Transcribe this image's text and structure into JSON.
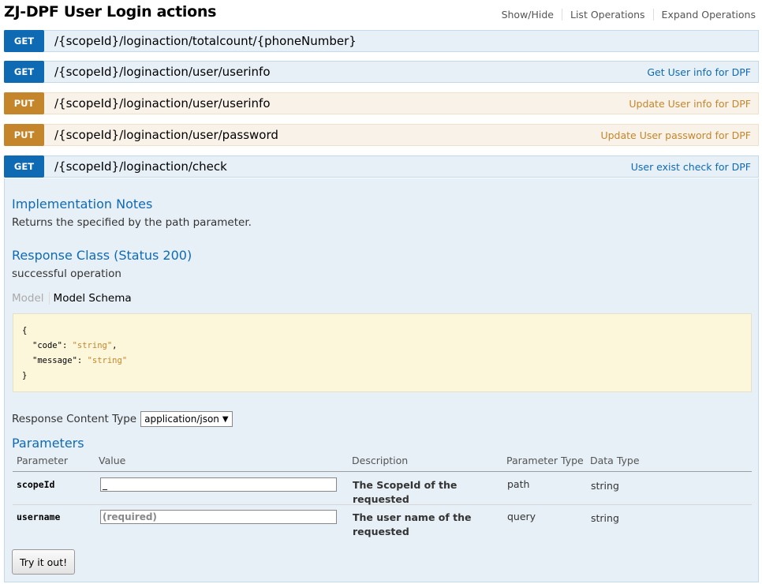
{
  "header": {
    "title": "ZJ-DPF User Login actions",
    "links": [
      "Show/Hide",
      "List Operations",
      "Expand Operations"
    ]
  },
  "operations": [
    {
      "method": "GET",
      "path": "/{scopeId}/loginaction/totalcount/{phoneNumber}",
      "summary": ""
    },
    {
      "method": "GET",
      "path": "/{scopeId}/loginaction/user/userinfo",
      "summary": "Get User info for DPF"
    },
    {
      "method": "PUT",
      "path": "/{scopeId}/loginaction/user/userinfo",
      "summary": "Update User info for DPF"
    },
    {
      "method": "PUT",
      "path": "/{scopeId}/loginaction/user/password",
      "summary": "Update User password for DPF"
    },
    {
      "method": "GET",
      "path": "/{scopeId}/loginaction/check",
      "summary": "User exist check for DPF"
    }
  ],
  "details": {
    "impl_heading": "Implementation Notes",
    "impl_text": "Returns the specified by the path parameter.",
    "response_heading": "Response Class (Status 200)",
    "response_text": "successful operation",
    "tab_model": "Model",
    "tab_schema": "Model Schema",
    "schema": {
      "open": "{",
      "line1_key": "\"code\"",
      "line1_sep": ": ",
      "line1_val": "\"string\"",
      "line1_end": ",",
      "line2_key": "\"message\"",
      "line2_sep": ": ",
      "line2_val": "\"string\"",
      "close": "}"
    },
    "content_type_label": "Response Content Type",
    "content_type_value": "application/json",
    "params_heading": "Parameters",
    "param_columns": [
      "Parameter",
      "Value",
      "Description",
      "Parameter Type",
      "Data Type"
    ],
    "params": [
      {
        "name": "scopeId",
        "value": "_",
        "placeholder": "",
        "description": "The ScopeId of the requested",
        "ptype": "path",
        "dtype": "string"
      },
      {
        "name": "username",
        "value": "",
        "placeholder": "(required)",
        "description": "The user name of the requested",
        "ptype": "query",
        "dtype": "string"
      }
    ],
    "try_button": "Try it out!"
  },
  "colors": {
    "get": "#0f6ab4",
    "put": "#c5862b",
    "get_bg": "#e7f0f7",
    "put_bg": "#f9f2e9",
    "schema_bg": "#fcf6db"
  }
}
